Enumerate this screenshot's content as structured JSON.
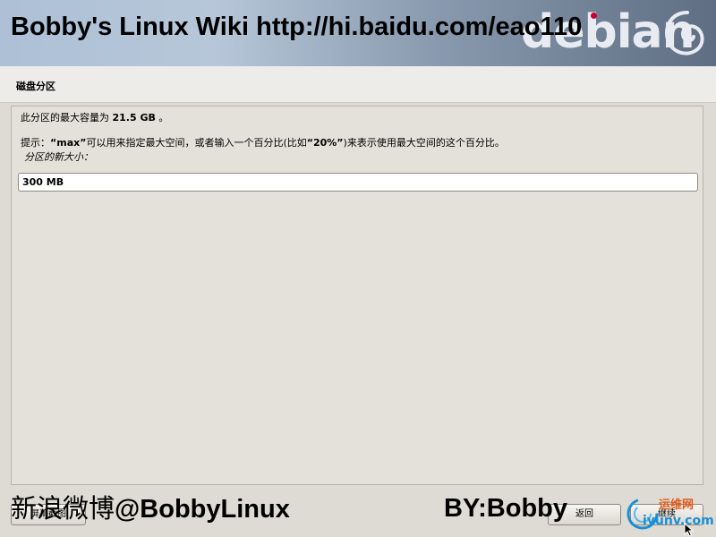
{
  "header": {
    "watermark_title": "Bobby's Linux Wiki    http://hi.baidu.com/eao110",
    "logo_word": "debian"
  },
  "section": {
    "title": "磁盘分区"
  },
  "panel": {
    "info_prefix": "此分区的最大容量为 ",
    "info_size": "21.5 GB",
    "info_suffix": " 。",
    "hint_prefix": "提示：",
    "hint_max": "“max”",
    "hint_middle": "可以用来指定最大空间，或者输入一个百分比(比如",
    "hint_pct": "“20%”",
    "hint_suffix": ")来表示使用最大空间的这个百分比。",
    "field_label": "分区的新大小：",
    "field_value": "300 MB"
  },
  "buttons": {
    "screenshot": "屏幕截图",
    "back": "返回",
    "continue": "继续"
  },
  "watermarks": {
    "weibo_cn": "新浪微博",
    "weibo_handle": "@BobbyLinux",
    "by": "BY:Bobby",
    "site_cn": "运维网",
    "site_en": "iyunv.com"
  },
  "colors": {
    "banner_start": "#adc0d6",
    "banner_end": "#5f6e82",
    "debian_red": "#c70036",
    "background": "#dedbd4"
  }
}
